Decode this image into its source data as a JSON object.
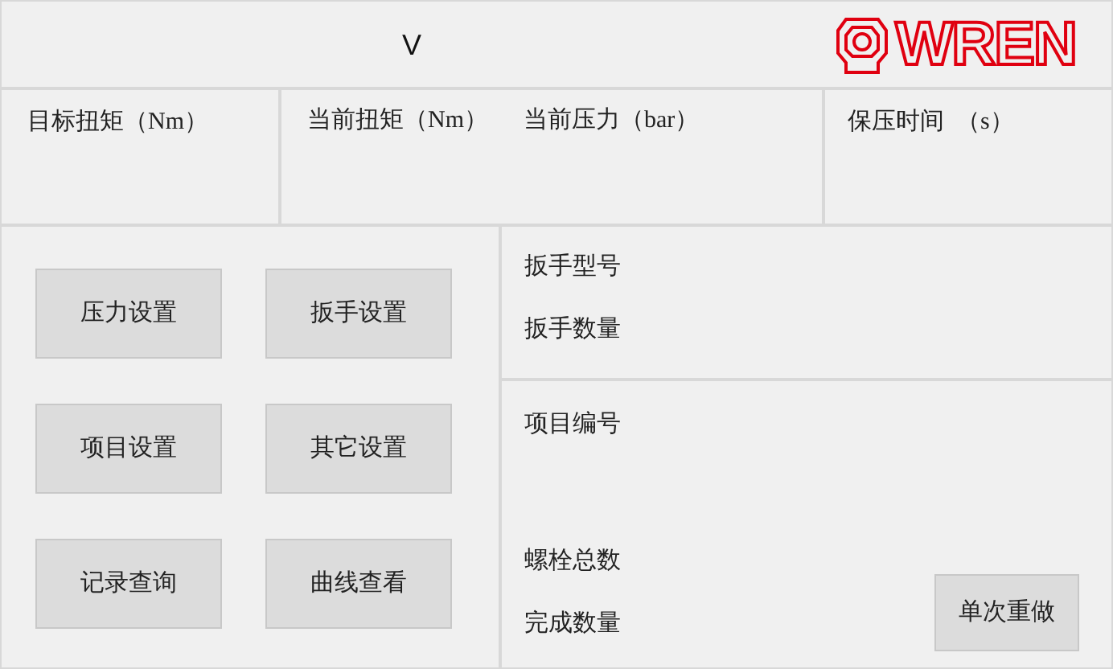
{
  "header": {
    "title": "V",
    "logo": "WREN"
  },
  "readouts": [
    {
      "label": "目标扭矩（Nm）"
    },
    {
      "label": "当前扭矩（Nm）"
    },
    {
      "label": "当前压力（bar）"
    },
    {
      "label": "保压时间  （s）"
    }
  ],
  "menu_buttons": [
    "压力设置",
    "扳手设置",
    "项目设置",
    "其它设置",
    "记录查询",
    "曲线查看"
  ],
  "wrench_info": [
    "扳手型号",
    "扳手数量"
  ],
  "project_info": {
    "number_label": "项目编号",
    "bolt_total_label": "螺栓总数",
    "completed_label": "完成数量",
    "redo_button": "单次重做"
  }
}
